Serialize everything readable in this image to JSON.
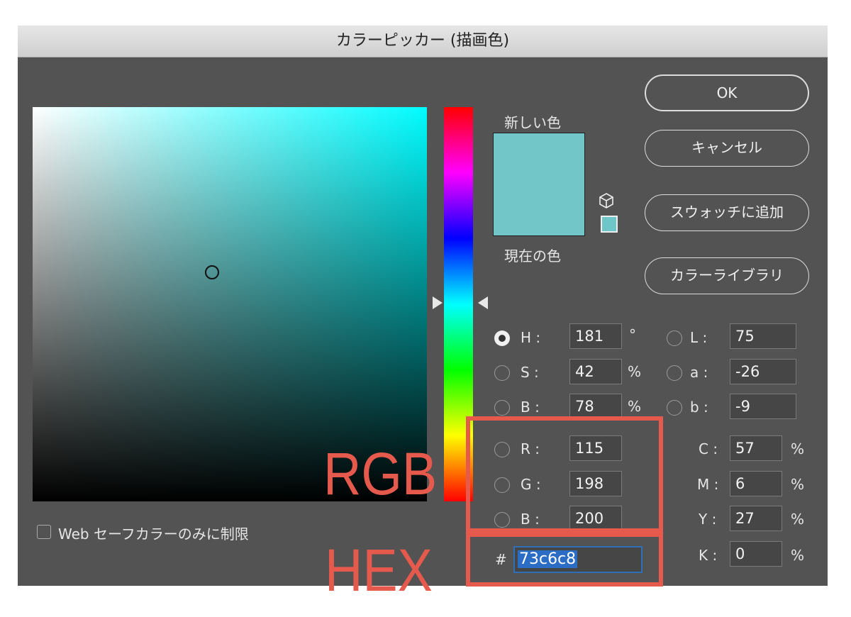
{
  "window": {
    "title": "カラーピッカー (描画色)"
  },
  "swatch": {
    "new_label": "新しい色",
    "current_label": "現在の色",
    "new_color": "#73c6c8"
  },
  "buttons": {
    "ok": "OK",
    "cancel": "キャンセル",
    "add_swatch": "スウォッチに追加",
    "color_library": "カラーライブラリ"
  },
  "hsb": {
    "h": {
      "label": "H :",
      "value": "181",
      "unit": "°",
      "selected": true
    },
    "s": {
      "label": "S :",
      "value": "42",
      "unit": "%"
    },
    "b": {
      "label": "B :",
      "value": "78",
      "unit": "%"
    }
  },
  "rgb": {
    "r": {
      "label": "R :",
      "value": "115"
    },
    "g": {
      "label": "G :",
      "value": "198"
    },
    "b": {
      "label": "B :",
      "value": "200"
    }
  },
  "lab": {
    "l": {
      "label": "L :",
      "value": "75"
    },
    "a": {
      "label": "a :",
      "value": "-26"
    },
    "b": {
      "label": "b :",
      "value": "-9"
    }
  },
  "cmyk": {
    "c": {
      "label": "C :",
      "value": "57",
      "unit": "%"
    },
    "m": {
      "label": "M :",
      "value": "6",
      "unit": "%"
    },
    "y": {
      "label": "Y :",
      "value": "27",
      "unit": "%"
    },
    "k": {
      "label": "K :",
      "value": "0",
      "unit": "%"
    }
  },
  "hex": {
    "prefix": "#",
    "value": "73c6c8"
  },
  "websafe": {
    "label": "Web セーフカラーのみに制限",
    "checked": false
  },
  "annotations": {
    "rgb_label": "RGB",
    "hex_label": "HEX",
    "color": "#e55a4c"
  }
}
